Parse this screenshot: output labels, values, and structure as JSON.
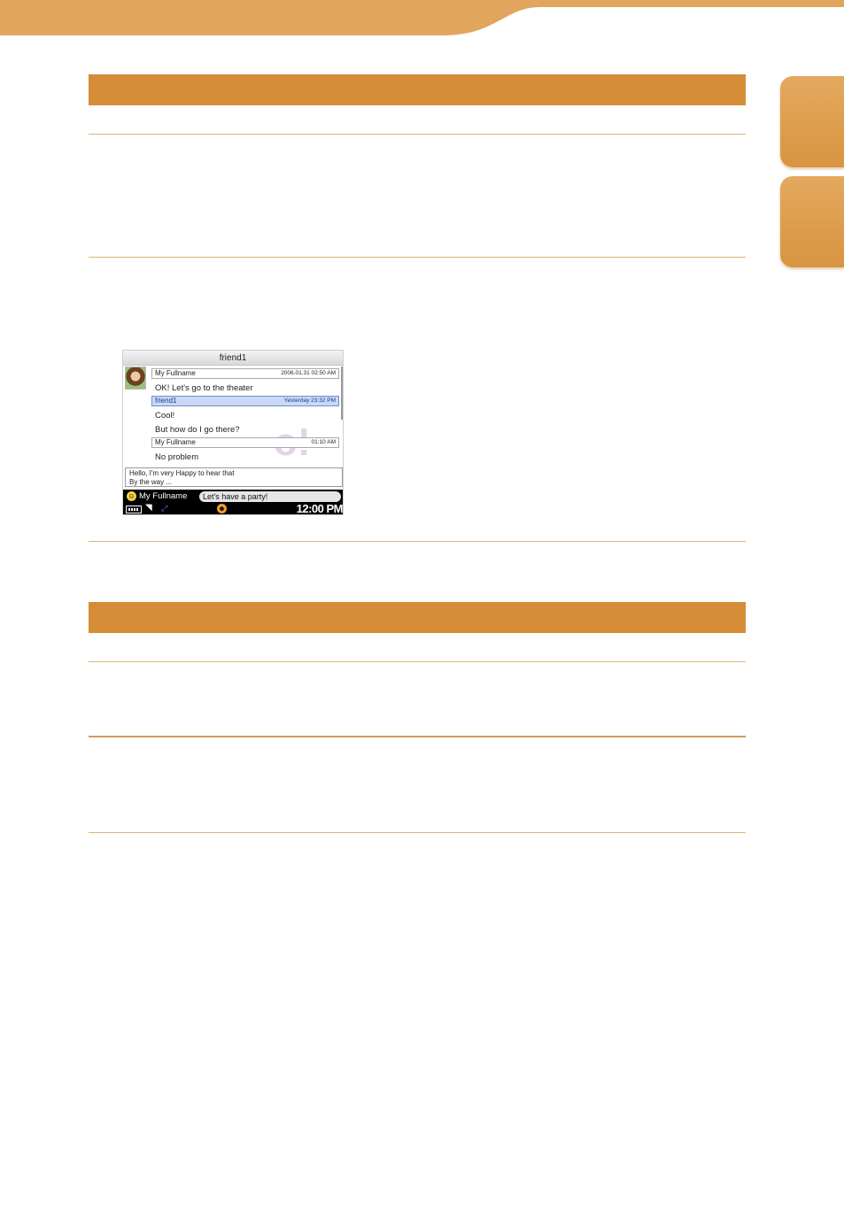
{
  "chat": {
    "title": "friend1",
    "messages": [
      {
        "sender": "My Fullname",
        "timestamp": "2006.01.31 02:50 AM",
        "lines": [
          "OK! Let's go to the theater"
        ]
      },
      {
        "sender": "friend1",
        "timestamp": "Yesterday 23:32 PM",
        "lines": [
          "Cool!",
          "But how do I go there?"
        ],
        "selected": true
      },
      {
        "sender": "My Fullname",
        "timestamp": "01:10 AM",
        "lines": [
          "No problem"
        ]
      }
    ],
    "input_lines": [
      "Hello, I'm very Happy to hear that",
      "By the way ..."
    ],
    "status": {
      "name": "My Fullname",
      "status_message": "Let's have a party!",
      "time": "12:00 PM"
    }
  },
  "colors": {
    "accent": "#d68c37",
    "tab": "#e0a155",
    "selection": "#c9d8f4"
  },
  "icons": [
    "smiley-icon",
    "battery-icon",
    "wifi-icon",
    "connection-icon",
    "emoticon-icon"
  ]
}
